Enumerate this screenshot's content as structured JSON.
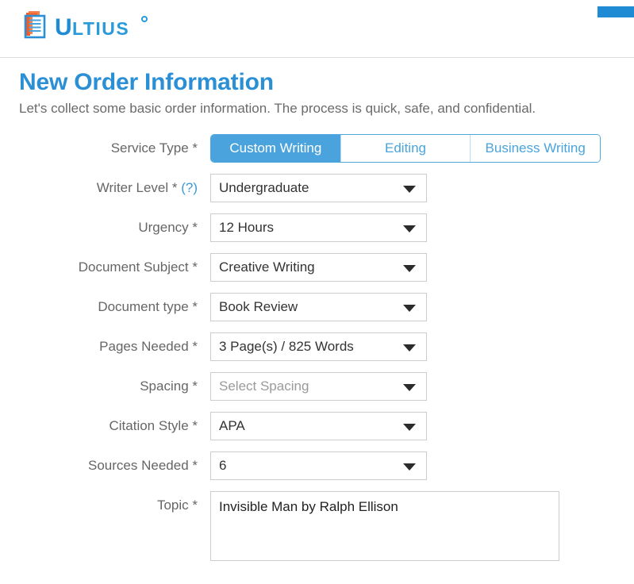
{
  "brand": {
    "name": "Ultius",
    "trademark": "®",
    "logo_icon": "document-logo-icon",
    "accent_blue": "#1e8bd4",
    "accent_orange": "#f05a28"
  },
  "header": {
    "title": "New Order Information",
    "subtitle": "Let's collect some basic order information. The process is quick, safe, and confidential."
  },
  "form": {
    "service_type": {
      "label": "Service Type *",
      "tabs": [
        {
          "label": "Custom Writing",
          "active": true
        },
        {
          "label": "Editing",
          "active": false
        },
        {
          "label": "Business Writing",
          "active": false
        }
      ]
    },
    "fields": [
      {
        "name": "writer-level",
        "label": "Writer Level *",
        "help": "(?)",
        "value": "Undergraduate",
        "is_placeholder": false
      },
      {
        "name": "urgency",
        "label": "Urgency *",
        "value": "12 Hours",
        "is_placeholder": false
      },
      {
        "name": "document-subject",
        "label": "Document Subject *",
        "value": "Creative Writing",
        "is_placeholder": false
      },
      {
        "name": "document-type",
        "label": "Document type *",
        "value": "Book Review",
        "is_placeholder": false
      },
      {
        "name": "pages-needed",
        "label": "Pages Needed *",
        "value": "3 Page(s) / 825 Words",
        "is_placeholder": false
      },
      {
        "name": "spacing",
        "label": "Spacing *",
        "value": "Select Spacing",
        "is_placeholder": true
      },
      {
        "name": "citation-style",
        "label": "Citation Style *",
        "value": "APA",
        "is_placeholder": false
      },
      {
        "name": "sources-needed",
        "label": "Sources Needed *",
        "value": "6",
        "is_placeholder": false
      }
    ],
    "topic": {
      "label": "Topic *",
      "value": "Invisible Man by Ralph Ellison"
    }
  },
  "icons": {
    "dropdown_arrow": "chevron-down-icon"
  }
}
